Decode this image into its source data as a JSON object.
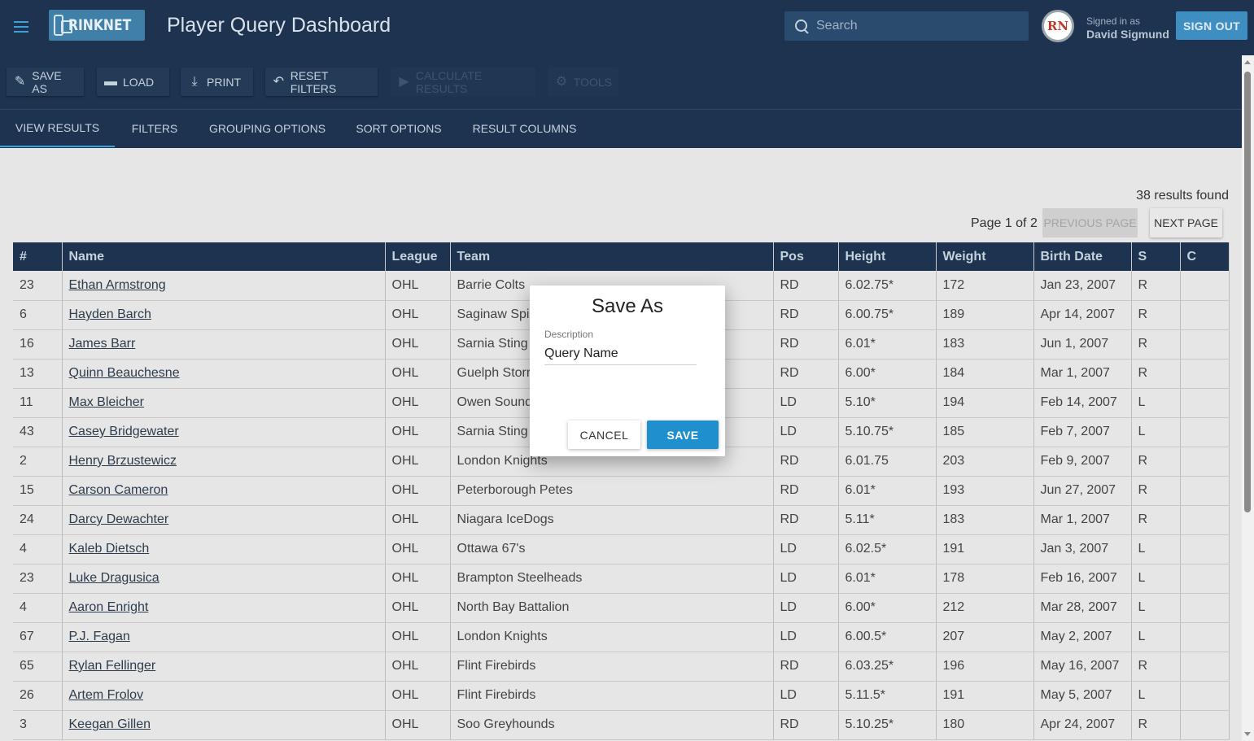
{
  "app": {
    "logo_text": "RINKNET",
    "title": "Player Query Dashboard",
    "search_placeholder": "Search",
    "signed_in_label": "Signed in as",
    "user_name": "David Sigmund",
    "avatar_initials": "RN",
    "sign_out_label": "SIGN OUT"
  },
  "toolbar": {
    "save_as": "SAVE AS",
    "load": "LOAD",
    "print": "PRINT",
    "reset_filters": "RESET FILTERS",
    "calculate_results": "CALCULATE RESULTS",
    "tools": "TOOLS"
  },
  "tabs": [
    "VIEW RESULTS",
    "FILTERS",
    "GROUPING OPTIONS",
    "SORT OPTIONS",
    "RESULT COLUMNS"
  ],
  "results": {
    "count_text": "38 results found",
    "page_text": "Page 1 of 2",
    "previous_label": "PREVIOUS PAGE",
    "next_label": "NEXT PAGE"
  },
  "table": {
    "headers": [
      "#",
      "Name",
      "League",
      "Team",
      "Pos",
      "Height",
      "Weight",
      "Birth Date",
      "S",
      "C"
    ],
    "rows": [
      [
        "23",
        "Ethan Armstrong",
        "OHL",
        "Barrie Colts",
        "RD",
        "6.02.75*",
        "172",
        "Jan 23, 2007",
        "R",
        ""
      ],
      [
        "6",
        "Hayden Barch",
        "OHL",
        "Saginaw Spirit",
        "RD",
        "6.00.75*",
        "189",
        "Apr 14, 2007",
        "R",
        ""
      ],
      [
        "16",
        "James Barr",
        "OHL",
        "Sarnia Sting",
        "RD",
        "6.01*",
        "183",
        "Jun 1, 2007",
        "R",
        ""
      ],
      [
        "13",
        "Quinn Beauchesne",
        "OHL",
        "Guelph Storm",
        "RD",
        "6.00*",
        "184",
        "Mar 1, 2007",
        "R",
        ""
      ],
      [
        "11",
        "Max Bleicher",
        "OHL",
        "Owen Sound Attack",
        "LD",
        "5.10*",
        "194",
        "Feb 14, 2007",
        "L",
        ""
      ],
      [
        "43",
        "Casey Bridgewater",
        "OHL",
        "Sarnia Sting",
        "LD",
        "5.10.75*",
        "185",
        "Feb 7, 2007",
        "L",
        ""
      ],
      [
        "2",
        "Henry Brzustewicz",
        "OHL",
        "London Knights",
        "RD",
        "6.01.75",
        "203",
        "Feb 9, 2007",
        "R",
        ""
      ],
      [
        "15",
        "Carson Cameron",
        "OHL",
        "Peterborough Petes",
        "RD",
        "6.01*",
        "193",
        "Jun 27, 2007",
        "R",
        ""
      ],
      [
        "24",
        "Darcy Dewachter",
        "OHL",
        "Niagara IceDogs",
        "RD",
        "5.11*",
        "183",
        "Mar 1, 2007",
        "R",
        ""
      ],
      [
        "4",
        "Kaleb Dietsch",
        "OHL",
        "Ottawa 67's",
        "LD",
        "6.02.5*",
        "191",
        "Jan 3, 2007",
        "L",
        ""
      ],
      [
        "23",
        "Luke Dragusica",
        "OHL",
        "Brampton Steelheads",
        "LD",
        "6.01*",
        "178",
        "Feb 16, 2007",
        "L",
        ""
      ],
      [
        "4",
        "Aaron Enright",
        "OHL",
        "North Bay Battalion",
        "LD",
        "6.00*",
        "212",
        "Mar 28, 2007",
        "L",
        ""
      ],
      [
        "67",
        "P.J. Fagan",
        "OHL",
        "London Knights",
        "LD",
        "6.00.5*",
        "207",
        "May 2, 2007",
        "L",
        ""
      ],
      [
        "65",
        "Rylan Fellinger",
        "OHL",
        "Flint Firebirds",
        "RD",
        "6.03.25*",
        "196",
        "May 16, 2007",
        "R",
        ""
      ],
      [
        "26",
        "Artem Frolov",
        "OHL",
        "Flint Firebirds",
        "LD",
        "5.11.5*",
        "191",
        "May 5, 2007",
        "L",
        ""
      ],
      [
        "3",
        "Keegan Gillen",
        "OHL",
        "Soo Greyhounds",
        "RD",
        "5.10.25*",
        "180",
        "Apr 24, 2007",
        "R",
        ""
      ]
    ]
  },
  "dialog": {
    "title": "Save As",
    "field_label": "Description",
    "field_value": "Query Name",
    "cancel_label": "CANCEL",
    "save_label": "SAVE"
  },
  "colors": {
    "header_bg": "#1d3350",
    "accent": "#3fa0d8",
    "save_button": "#1f8fce"
  }
}
